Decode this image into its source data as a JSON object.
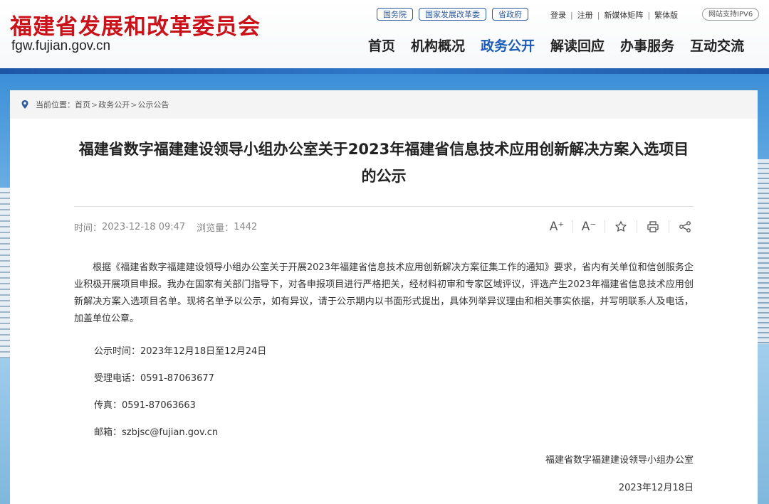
{
  "header": {
    "logo_title": "福建省发展和改革委员会",
    "logo_domain": "fgw.fujian.gov.cn",
    "gov_links": [
      "国务院",
      "国家发展改革委",
      "省政府"
    ],
    "user_links": [
      "登录",
      "注册",
      "新媒体矩阵",
      "繁体版"
    ],
    "ipv6_badge": "网站支持IPV6",
    "nav": [
      "首页",
      "机构概况",
      "政务公开",
      "解读回应",
      "办事服务",
      "互动交流"
    ],
    "active_nav": "政务公开",
    "accent_color": "#1a5bb5",
    "brand_color": "#c9121a"
  },
  "breadcrumb": {
    "prefix": "当前位置：",
    "items": [
      "首页",
      "政务公开",
      "公示公告"
    ]
  },
  "article": {
    "title": "福建省数字福建建设领导小组办公室关于2023年福建省信息技术应用创新解决方案入选项目的公示",
    "time_label": "时间：",
    "time_value": "2023-12-18 09:47",
    "views_label": "浏览量：",
    "views_value": "1442",
    "tools": {
      "font_increase": "A⁺",
      "font_decrease": "A⁻"
    },
    "paragraph": "根据《福建省数字福建建设领导小组办公室关于开展2023年福建省信息技术应用创新解决方案征集工作的通知》要求，省内有关单位和信创服务企业积极开展项目申报。我办在国家有关部门指导下，对各申报项目进行严格把关，经材料初审和专家区域评议，评选产生2023年福建省信息技术应用创新解决方案入选项目名单。现将名单予以公示，如有异议，请于公示期内以书面形式提出，具体列举异议理由和相关事实依据，并写明联系人及电话，加盖单位公章。",
    "period": "公示时间：2023年12月18日至12月24日",
    "phone": "受理电话：0591-87063677",
    "fax": "传真：0591-87063663",
    "email": "邮箱：szbjsc@fujian.gov.cn",
    "signature": "福建省数字福建建设领导小组办公室",
    "date": "2023年12月18日"
  }
}
